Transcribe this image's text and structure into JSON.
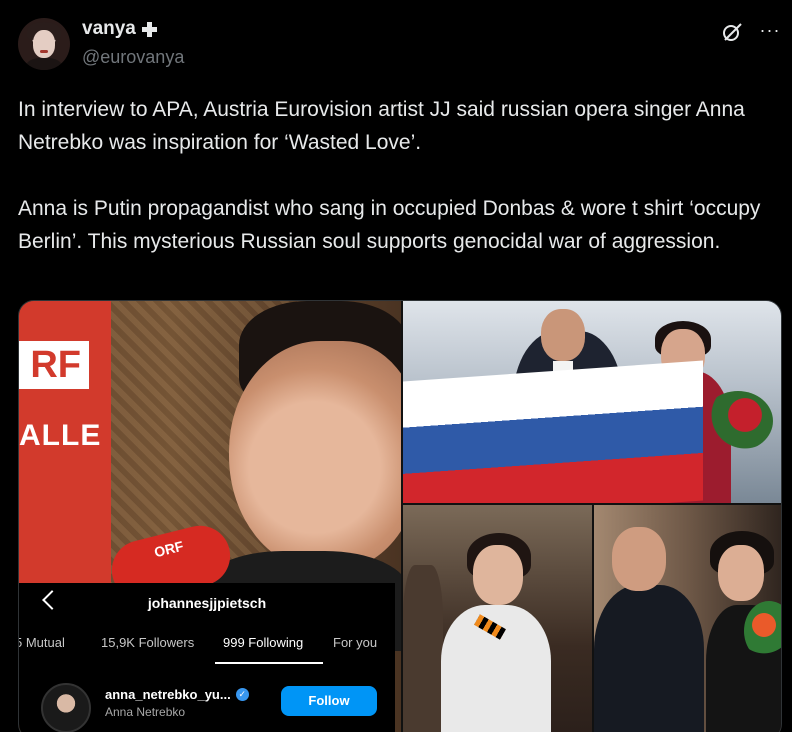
{
  "author": {
    "display_name": "vanya",
    "handle": "@eurovanya",
    "name_badge_icon": "cross-icon"
  },
  "header_actions": {
    "grok_icon": "grok-icon",
    "more_icon": "more-icon",
    "more_label": "···"
  },
  "tweet": {
    "paragraph1": "In interview to APA, Austria Eurovision artist JJ said russian opera singer Anna Netrebko was inspiration for ‘Wasted Love’.",
    "paragraph2": "Anna is Putin propagandist who sang in occupied Donbas & wore t shirt ‘occupy Berlin’. This mysterious Russian soul supports genocidal war of aggression."
  },
  "media": {
    "left_image": {
      "banner_logo": "RF",
      "banner_text": "ALLE",
      "mic_label": "ORF"
    },
    "instagram": {
      "username": "johannesjjpietsch",
      "tabs": [
        "5 Mutual",
        "15,9K Followers",
        "999 Following",
        "For you"
      ],
      "active_tab": "999 Following",
      "row": {
        "username": "anna_netrebko_yu...",
        "full_name": "Anna Netrebko",
        "follow_label": "Follow"
      }
    }
  },
  "colors": {
    "background": "#000000",
    "text": "#e7e9ea",
    "muted": "#71767b",
    "follow_button": "#0095f6",
    "orf_red": "#d23a2c"
  }
}
